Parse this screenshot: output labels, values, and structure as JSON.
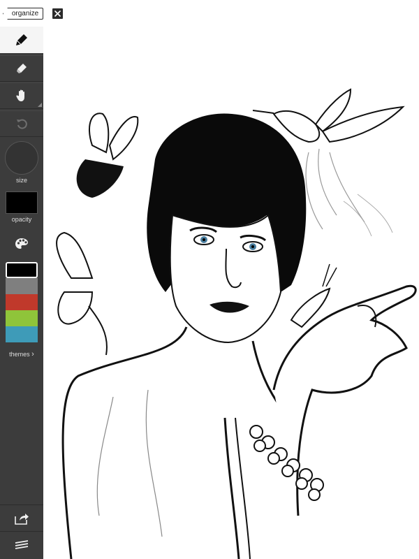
{
  "topbar": {
    "organize_label": "organize",
    "close_icon": "close-icon"
  },
  "sidebar": {
    "tools": [
      {
        "name": "brush",
        "icon": "brush-icon",
        "active": true
      },
      {
        "name": "eraser",
        "icon": "eraser-icon",
        "active": false
      },
      {
        "name": "hand",
        "icon": "hand-icon",
        "active": false
      },
      {
        "name": "undo",
        "icon": "undo-icon",
        "active": false
      }
    ],
    "size_label": "size",
    "opacity_label": "opacity",
    "palette_icon": "palette-icon",
    "colors": [
      "#000000",
      "#7f7f7f",
      "#c0392b",
      "#8fc43a",
      "#3e9bb8"
    ],
    "selected_color": "#000000",
    "themes_label": "themes",
    "themes_chevron": "›",
    "bottom_tools": [
      {
        "name": "export",
        "icon": "export-icon"
      },
      {
        "name": "layers",
        "icon": "layers-icon"
      }
    ]
  },
  "colors": {
    "sidebar_bg": "#3c3c3c",
    "active_tool_bg": "#f5f5f5",
    "canvas_bg": "#ffffff"
  }
}
